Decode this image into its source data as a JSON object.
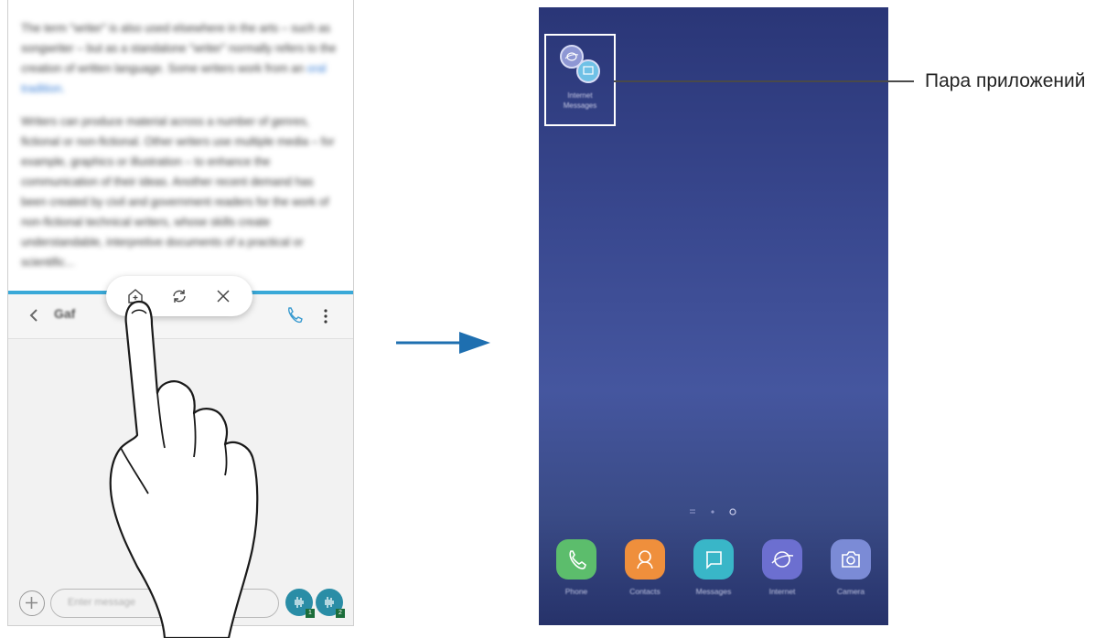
{
  "left_screen": {
    "article": {
      "paragraph1": "The term \"writer\" is also used elsewhere in the arts – such as songwriter – but as a standalone \"writer\" normally refers to the creation of written language. Some writers work from an",
      "paragraph1_link": "oral tradition.",
      "paragraph2": "Writers can produce material across a number of genres, fictional or non-fictional. Other writers use multiple media – for example, graphics or illustration – to enhance the communication of their ideas. Another recent demand has been created by civil and government readers for the work of non-fictional technical writers, whose skills create understandable, interpretive documents of a practical or scientific..."
    },
    "messages": {
      "contact_name": "Gaf",
      "input_placeholder": "Enter message",
      "sim1_badge": "1",
      "sim2_badge": "2"
    }
  },
  "right_screen": {
    "app_pair_label_line1": "Internet",
    "app_pair_label_line2": "Messages",
    "dock": [
      {
        "label": "Phone",
        "icon": "phone-icon",
        "color": "#5cbd6c"
      },
      {
        "label": "Contacts",
        "icon": "contacts-icon",
        "color": "#ef8f3c"
      },
      {
        "label": "Messages",
        "icon": "messages-icon",
        "color": "#39b6c8"
      },
      {
        "label": "Internet",
        "icon": "internet-icon",
        "color": "#6c6fd0"
      },
      {
        "label": "Camera",
        "icon": "camera-icon",
        "color": "#7b8bd6"
      }
    ]
  },
  "callout": {
    "text": "Пара приложений"
  },
  "colors": {
    "split_bar": "#3aa9d8",
    "arrow": "#1e6fb0"
  }
}
